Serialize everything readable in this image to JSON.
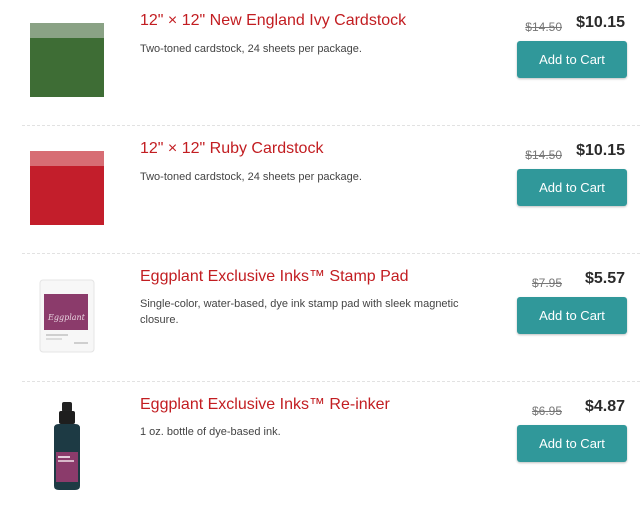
{
  "products": [
    {
      "title": "12\" × 12\" New England Ivy Cardstock",
      "description": "Two-toned cardstock, 24 sheets per package.",
      "old_price": "$14.50",
      "new_price": "$10.15",
      "button": "Add to Cart",
      "thumb": "new-england-ivy-swatch",
      "colors": {
        "light": "#8aa285",
        "dark": "#3e6d35"
      }
    },
    {
      "title": "12\" × 12\" Ruby Cardstock",
      "description": "Two-toned cardstock, 24 sheets per package.",
      "old_price": "$14.50",
      "new_price": "$10.15",
      "button": "Add to Cart",
      "thumb": "ruby-swatch",
      "colors": {
        "light": "#d76d74",
        "dark": "#c31e2b"
      }
    },
    {
      "title": "Eggplant Exclusive Inks™ Stamp Pad",
      "description": "Single-color, water-based, dye ink stamp pad with sleek magnetic closure.",
      "old_price": "$7.95",
      "new_price": "$5.57",
      "button": "Add to Cart",
      "thumb": "stamp-pad",
      "colors": {
        "ink": "#8b3b6b"
      }
    },
    {
      "title": "Eggplant Exclusive Inks™ Re-inker",
      "description": "1 oz. bottle of dye-based ink.",
      "old_price": "$6.95",
      "new_price": "$4.87",
      "button": "Add to Cart",
      "thumb": "reinker-bottle",
      "colors": {
        "ink": "#8b3b6b"
      }
    }
  ],
  "colors": {
    "title": "#c21d21",
    "button": "#30989a"
  }
}
